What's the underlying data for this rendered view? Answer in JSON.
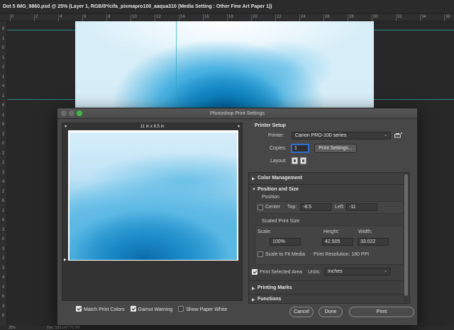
{
  "document": {
    "tab_title": "Dot 5 IMG_9860.psd @ 25% (Layer 1, RGB/8*/cifa_pixmapro100_aaqua310 (Media Setting : Other Fine Art Paper 1))",
    "ruler_top": [
      "0",
      "2",
      "4",
      "6",
      "8",
      "10",
      "12",
      "14",
      "16",
      "18",
      "20",
      "22",
      "24",
      "26",
      "28",
      "30",
      "32",
      "34",
      "36"
    ],
    "ruler_left": [
      "8",
      "1",
      "0",
      "1",
      "2",
      "1",
      "4",
      "1",
      "6",
      "1",
      "8",
      "2",
      "0",
      "2",
      "2",
      "2",
      "4",
      "2",
      "6",
      "2",
      "8",
      "3",
      "0",
      "3",
      "2",
      "3",
      "4",
      "3",
      "6",
      "3",
      "8"
    ],
    "status_zoom": "25%",
    "status_doc": "Doc: 130.1M/778.6M"
  },
  "dialog": {
    "title": "Photoshop Print Settings",
    "traffic_colors": [
      "#6b6b6b",
      "#6b6b6b",
      "#3dbb3f"
    ],
    "preview": {
      "paper_size": "11 in x 8.5 in"
    },
    "checkboxes": {
      "match_print_colors": {
        "label": "Match Print Colors",
        "checked": true
      },
      "gamut_warning": {
        "label": "Gamut Warning",
        "checked": true
      },
      "show_paper_white": {
        "label": "Show Paper White",
        "checked": false
      }
    },
    "printer_setup": {
      "heading": "Printer Setup",
      "printer_label": "Printer:",
      "printer_value": "Canon PRO-100 series",
      "copies_label": "Copies:",
      "copies_value": "1",
      "print_settings_button": "Print Settings...",
      "layout_label": "Layout:"
    },
    "sections": {
      "color_management": "Color Management",
      "position_and_size": "Position and Size",
      "position_label": "Position",
      "center_label": "Center",
      "center_checked": false,
      "top_label": "Top:",
      "top_value": "-8.5",
      "left_label": "Left:",
      "left_value": "-11",
      "scaled_print_size": "Scaled Print Size",
      "scale_label": "Scale:",
      "height_label": "Height:",
      "width_label": "Width:",
      "scale_value": "100%",
      "height_value": "42.505",
      "width_value": "33.022",
      "scale_to_fit_label": "Scale to Fit Media",
      "scale_to_fit_checked": false,
      "print_resolution": "Print Resolution: 180 PPI",
      "print_selected_area_label": "Print Selected Area",
      "print_selected_area_checked": true,
      "units_label": "Units:",
      "units_value": "Inches",
      "printing_marks": "Printing Marks",
      "functions": "Functions"
    },
    "buttons": {
      "cancel": "Cancel",
      "done": "Done",
      "print": "Print"
    }
  }
}
